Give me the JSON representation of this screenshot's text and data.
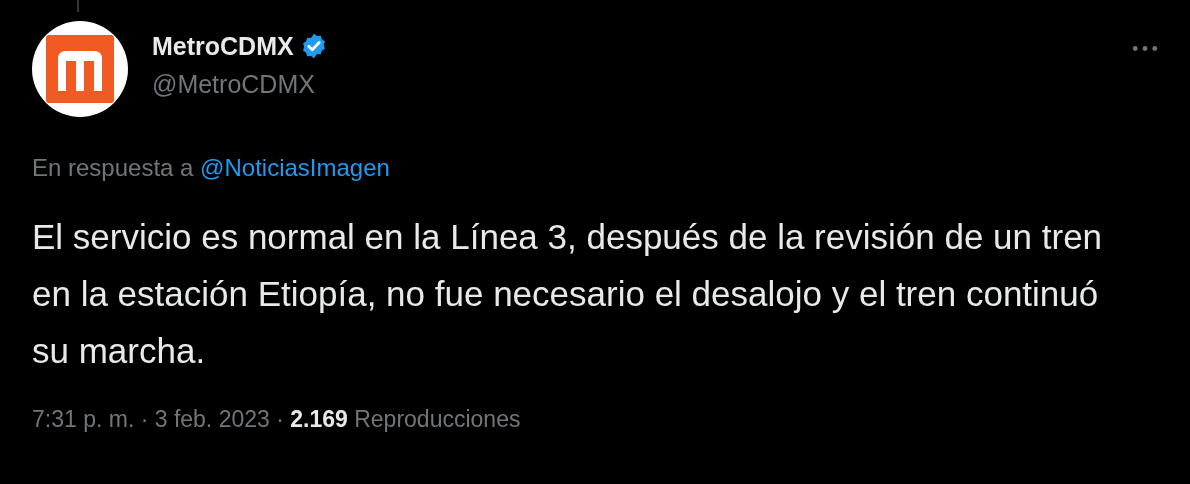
{
  "author": {
    "name": "MetroCDMX",
    "verified": true,
    "handle": "@MetroCDMX"
  },
  "reply_to": {
    "prefix": "En respuesta a",
    "handle": "@NoticiasImagen"
  },
  "text": "El servicio es normal en la Línea 3, después de la revisión de un tren en la estación Etiopía, no fue necesario el desalojo y el tren continuó su marcha.",
  "meta": "7:31 p. m. · 3 feb. 2023 · **2.169** Reproducciones"
}
